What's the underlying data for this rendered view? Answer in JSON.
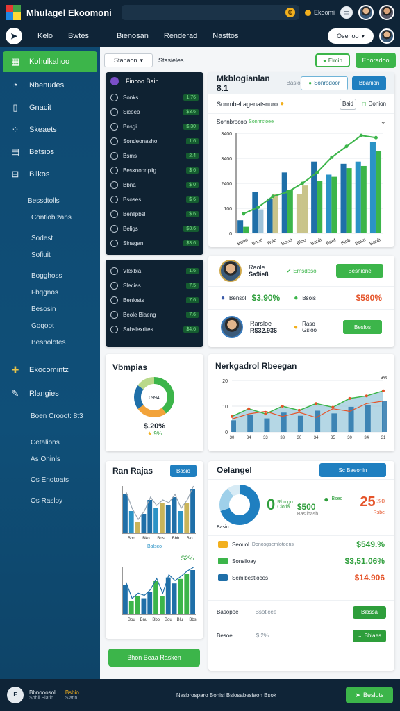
{
  "app": {
    "title": "Mhulagel Ekoomoni",
    "coin_glyph": "₵",
    "status_text": "Ekoomi",
    "window_icon": "window-icon"
  },
  "nav": {
    "links": [
      "Kelo",
      "Bwtes",
      "Bienosan",
      "Renderad",
      "Nasttos"
    ],
    "select_label": "Osenoo",
    "home_icon": "arrow-icon"
  },
  "sidebar": {
    "items": [
      {
        "label": "Kohulkahoo",
        "icon": "chart-icon",
        "active": true
      },
      {
        "label": "Nbenudes",
        "icon": "gauge-icon"
      },
      {
        "label": "Gnacit",
        "icon": "book-icon"
      },
      {
        "label": "Skeaets",
        "icon": "scatter-icon"
      },
      {
        "label": "Betsios",
        "icon": "stats-icon"
      },
      {
        "label": "Bilkos",
        "icon": "table-icon"
      }
    ],
    "group1_title": "Bessdtolls",
    "group1": [
      "Contiobizans",
      "Sodest",
      "Sofiuit",
      "Bogghoss",
      "Fbqgnos",
      "Besosin",
      "Goqoot",
      "Besnolotes"
    ],
    "items2": [
      {
        "label": "Ekocomintz",
        "icon": "plus-icon"
      },
      {
        "label": "Rlangies",
        "icon": "edit-icon"
      }
    ],
    "group2": [
      "Boen Crooot: 8t3",
      "Cetalions",
      "As Oninls",
      "Os Enotoats",
      "Os Rasloy"
    ]
  },
  "toolbar": {
    "select_label": "Stanaon",
    "label": "Stasieles",
    "outline_btn": "Elmin",
    "green_btn": "Enoradoo"
  },
  "dark_panel": {
    "header": "Fincoo Bain",
    "rows": [
      {
        "label": "Sonks",
        "value": "1.76"
      },
      {
        "label": "Sicoeo",
        "value": "$3.6"
      },
      {
        "label": "Bnsgi",
        "value": "$.30"
      },
      {
        "label": "Sondeonasho",
        "value": "1.6"
      },
      {
        "label": "Bsms",
        "value": "2.4"
      },
      {
        "label": "Besknoonpiig",
        "value": "$ 6"
      },
      {
        "label": "Bbna",
        "value": "$ 0"
      },
      {
        "label": "Bsoses",
        "value": "$ 6"
      },
      {
        "label": "Benllpbsl",
        "value": "$ 6"
      },
      {
        "label": "Beligs",
        "value": "$3.6"
      },
      {
        "label": "Sinagan",
        "value": "$3.6"
      }
    ],
    "rows2": [
      {
        "label": "Vlexbia",
        "value": "1.6"
      },
      {
        "label": "Slecias",
        "value": "7.5"
      },
      {
        "label": "Benlosts",
        "value": "7.6"
      },
      {
        "label": "Beole Biaeng",
        "value": "7.6"
      },
      {
        "label": "Sahslexrites",
        "value": "$4.6"
      }
    ]
  },
  "main_chart": {
    "title": "Mkblogianlan 8.1",
    "title_tag": "Basio",
    "btn_outline": "Sonrodoor",
    "btn_blue": "Bbanion",
    "sub_title": "Sonmbel agenatsnuro",
    "sub_btn1": "Baid",
    "sub_btn2": "Donion",
    "filter_label": "Sonnbrocop",
    "filter_tag": "Sonnrstoee"
  },
  "chart_data": [
    {
      "type": "bar",
      "categories": [
        "Bodo",
        "Bnoo",
        "Bvio",
        "Bouo",
        "Blou",
        "Baub",
        "Bdot",
        "Blob",
        "Basn",
        "Baob"
      ],
      "series": [
        {
          "values": [
            60,
            190,
            160,
            280,
            180,
            330,
            270,
            320,
            330,
            420
          ]
        },
        {
          "values": [
            30,
            110,
            180,
            200,
            220,
            240,
            260,
            300,
            310,
            380
          ]
        }
      ],
      "line": [
        90,
        120,
        170,
        190,
        230,
        280,
        350,
        400,
        450,
        440
      ],
      "yticks": [
        "0",
        "100",
        "2400",
        "3400",
        "3400"
      ],
      "ylim": [
        0,
        460
      ]
    },
    {
      "type": "line",
      "title": "Nerkgadrol Rbeegan",
      "categories": [
        "30",
        "34",
        "33",
        "33",
        "30",
        "34",
        "35",
        "30",
        "34",
        "31"
      ],
      "series": [
        {
          "values": [
            30,
            45,
            35,
            50,
            42,
            55,
            48,
            65,
            70,
            80
          ]
        },
        {
          "values": [
            25,
            35,
            40,
            30,
            38,
            28,
            45,
            40,
            55,
            60
          ]
        }
      ],
      "yticks": [
        "0",
        "10",
        "20"
      ],
      "annotation": "3%",
      "ylim": [
        0,
        100
      ]
    }
  ],
  "profiles": [
    {
      "name": "Raole",
      "amount": "Sa9ie8",
      "status_label": "Emsdoso",
      "button": "Besnione",
      "stat1_label": "Bensol",
      "stat1_value": "$3.90%",
      "stat2_label": "Bsois",
      "stat2_value": "$580%"
    },
    {
      "name": "Rarsloe",
      "amount": "R$32.936",
      "stat_label": "Raso",
      "stat_value": "Gsloo",
      "button": "Beslos"
    }
  ],
  "donut_card": {
    "title": "Vbmpias",
    "center": "0994",
    "value": "$.20%",
    "sub": "9%",
    "segments": [
      40,
      25,
      20,
      15
    ]
  },
  "bar_card": {
    "title": "Ran Rajas",
    "button": "Basio",
    "caption": "Balsco",
    "note": "$2%"
  },
  "mini_chart1": {
    "values": [
      70,
      40,
      20,
      35,
      60,
      45,
      55,
      50,
      65,
      40,
      55,
      80
    ],
    "labels": [
      "Bbo",
      "Bko",
      "Bos",
      "Bbb",
      "Blo"
    ]
  },
  "mini_chart2": {
    "values": [
      40,
      18,
      25,
      22,
      30,
      45,
      25,
      50,
      42,
      48,
      55,
      60
    ],
    "labels": [
      "Bou",
      "Bnu",
      "Bbo",
      "Bou",
      "Blu",
      "Bbs"
    ]
  },
  "green_wide_button": "Bhon Beaa Rasken",
  "detail_card": {
    "title": "Oelangel",
    "button": "Sc Baeonin",
    "kpi_big": "0",
    "kpi_big_sub1": "Rbmgo",
    "kpi_big_sub2": "Clotia",
    "kpi_value": "$500",
    "kpi_value_sub": "Basilhasb",
    "kpi_right_label": "Bsec",
    "kpi_right_value": "25",
    "kpi_right_sup": "590",
    "kpi_right_sub": "Rsbe",
    "caption": "Basio",
    "rows": [
      {
        "label": "Seouol",
        "sub": "Donosgsemlotoens",
        "value": "$549.%"
      },
      {
        "label": "Sonsiloay",
        "sub": "",
        "value": "$3,51.06%"
      },
      {
        "label": "Semibestlocos",
        "sub": "",
        "value": "$14.906"
      }
    ],
    "footer1": {
      "label": "Basopoe",
      "sub": "Bsoticee",
      "button": "Bibssa"
    },
    "footer2": {
      "label": "Besoe",
      "value": "$ 2%",
      "button": "Bblaes"
    }
  },
  "bottombar": {
    "badge": "E",
    "title": "Bbnooosol",
    "sub": "Sobli Slatin",
    "label2": "Bsbio",
    "sub2": "Slatin",
    "center": "Nasbrosparo Bonisl  Bsiosabesiaon Bsok",
    "button": "Beslots"
  },
  "colors": {
    "navy": "#0f2437",
    "sidebar": "#0f4a72",
    "green": "#3cb54a",
    "blue": "#1f6fa8",
    "teal": "#2b93c6",
    "olive": "#c9b45a"
  }
}
